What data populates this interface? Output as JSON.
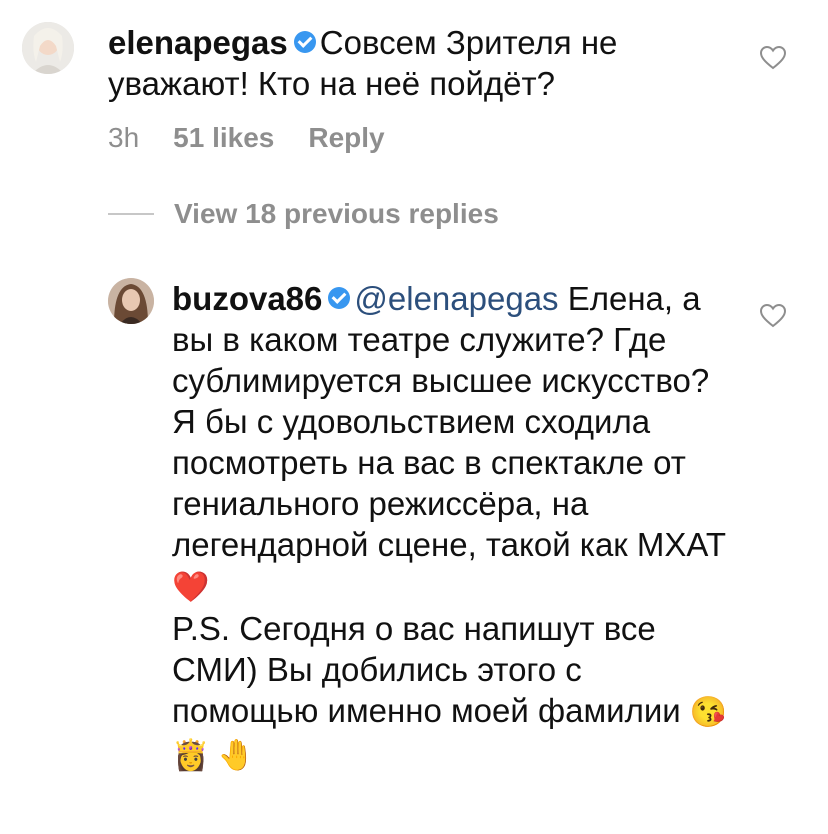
{
  "comment": {
    "username": "elenapegas",
    "text": "Совсем Зрителя не уважают! Кто на неё пойдёт?",
    "time": "3h",
    "likes": "51 likes",
    "reply_label": "Reply"
  },
  "view_replies": "View 18 previous replies",
  "reply": {
    "username": "buzova86",
    "mention": "@elenapegas",
    "text_part1": " Елена, а вы в каком театре служите? Где сублимируется высшее искусство? Я бы с удовольствием сходила посмотреть на вас в спектакле от гениального режиссёра, на легендарной сцене, такой как МХАТ ",
    "heart_emoji": "❤️",
    "text_part2": "P.S. Сегодня о вас напишут все СМИ) Вы добились этого с помощью именно моей фамилии ",
    "end_emojis": "😘 👸 🤚"
  },
  "colors": {
    "verified": "#3897f0",
    "mention": "#2c4f7c",
    "meta": "#8e8e8e"
  },
  "icons": [
    "verified-badge-icon",
    "heart-outline-icon",
    "avatar"
  ]
}
